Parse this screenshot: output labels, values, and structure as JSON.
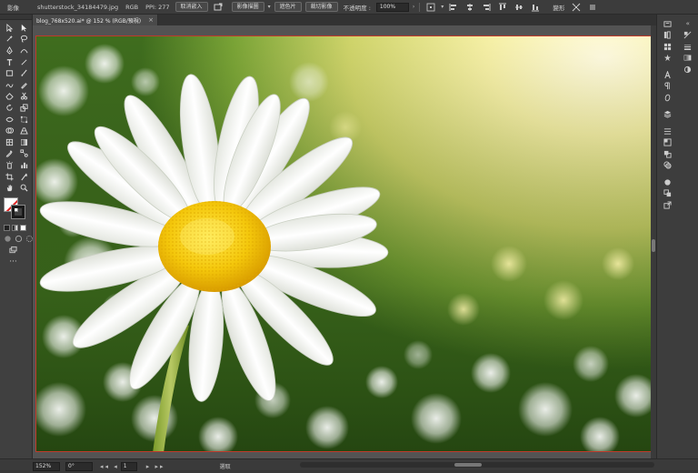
{
  "control_bar": {
    "object_type": "影像",
    "filename": "shutterstock_34184479.jpg",
    "color_mode": "RGB",
    "ppi": "PPI: 277",
    "buttons": [
      "取消嵌入",
      "影像描圖",
      "遮色片",
      "裁切影像"
    ],
    "opacity_label": "不透明度 :",
    "opacity_value": "100%",
    "transform_label": "變形"
  },
  "document_tab": {
    "title": "blog_768x520.ai* @ 152 % (RGB/預視)"
  },
  "status_bar": {
    "zoom": "152%",
    "rotation": "0°",
    "page": "1",
    "info": "選取"
  },
  "colors": {
    "accent_artboard": "#c0392b",
    "ui_dark": "#3c3c3c",
    "ui_mid": "#535353"
  }
}
